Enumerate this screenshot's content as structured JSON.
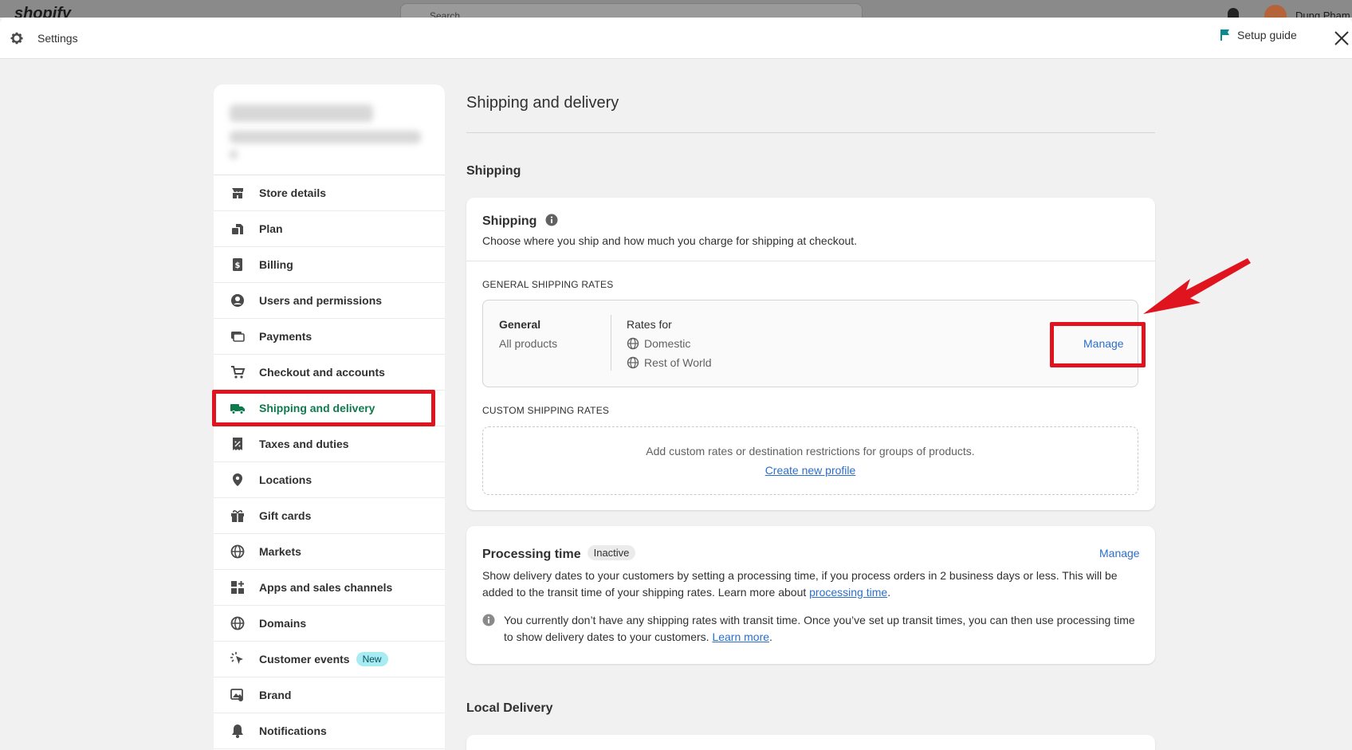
{
  "topbar": {
    "logo_text": "shopify",
    "search_placeholder": "Search",
    "user_name": "Dung Pham"
  },
  "header": {
    "title": "Settings",
    "setup_guide": "Setup guide"
  },
  "sidebar": {
    "items": [
      {
        "label": "Store details",
        "icon": "store-icon",
        "active": false
      },
      {
        "label": "Plan",
        "icon": "plan-icon",
        "active": false
      },
      {
        "label": "Billing",
        "icon": "billing-icon",
        "active": false
      },
      {
        "label": "Users and permissions",
        "icon": "user-icon",
        "active": false
      },
      {
        "label": "Payments",
        "icon": "payments-icon",
        "active": false
      },
      {
        "label": "Checkout and accounts",
        "icon": "cart-icon",
        "active": false
      },
      {
        "label": "Shipping and delivery",
        "icon": "truck-icon",
        "active": true
      },
      {
        "label": "Taxes and duties",
        "icon": "tax-icon",
        "active": false
      },
      {
        "label": "Locations",
        "icon": "location-icon",
        "active": false
      },
      {
        "label": "Gift cards",
        "icon": "gift-icon",
        "active": false
      },
      {
        "label": "Markets",
        "icon": "globe-icon",
        "active": false
      },
      {
        "label": "Apps and sales channels",
        "icon": "apps-icon",
        "active": false
      },
      {
        "label": "Domains",
        "icon": "globe-icon",
        "active": false
      },
      {
        "label": "Customer events",
        "icon": "cursor-icon",
        "active": false,
        "badge": "New"
      },
      {
        "label": "Brand",
        "icon": "brand-icon",
        "active": false
      },
      {
        "label": "Notifications",
        "icon": "bell-icon",
        "active": false
      }
    ]
  },
  "main": {
    "title": "Shipping and delivery",
    "shipping_section": "Shipping",
    "shipping_card": {
      "title": "Shipping",
      "description": "Choose where you ship and how much you charge for shipping at checkout.",
      "general_rates_label": "GENERAL SHIPPING RATES",
      "profile_name": "General",
      "profile_scope": "All products",
      "rates_for_label": "Rates for",
      "zones": [
        "Domestic",
        "Rest of World"
      ],
      "manage_label": "Manage",
      "custom_rates_label": "CUSTOM SHIPPING RATES",
      "custom_description": "Add custom rates or destination restrictions for groups of products.",
      "create_profile_link": "Create new profile"
    },
    "processing_card": {
      "title": "Processing time",
      "status_badge": "Inactive",
      "manage_label": "Manage",
      "description_part1": "Show delivery dates to your customers by setting a processing time, if you process orders in 2 business days or less. This will be added to the transit time of your shipping rates. Learn more about ",
      "description_link": "processing time",
      "description_end": ".",
      "info_text_part1": "You currently don’t have any shipping rates with transit time. Once you’ve set up transit times, you can then use processing time to show delivery dates to your customers. ",
      "info_link": "Learn more",
      "info_end": "."
    },
    "local_delivery_section": "Local Delivery"
  },
  "colors": {
    "accent_green": "#0f7a4d",
    "link_blue": "#2c6ecb",
    "highlight_red": "#e0141e"
  }
}
